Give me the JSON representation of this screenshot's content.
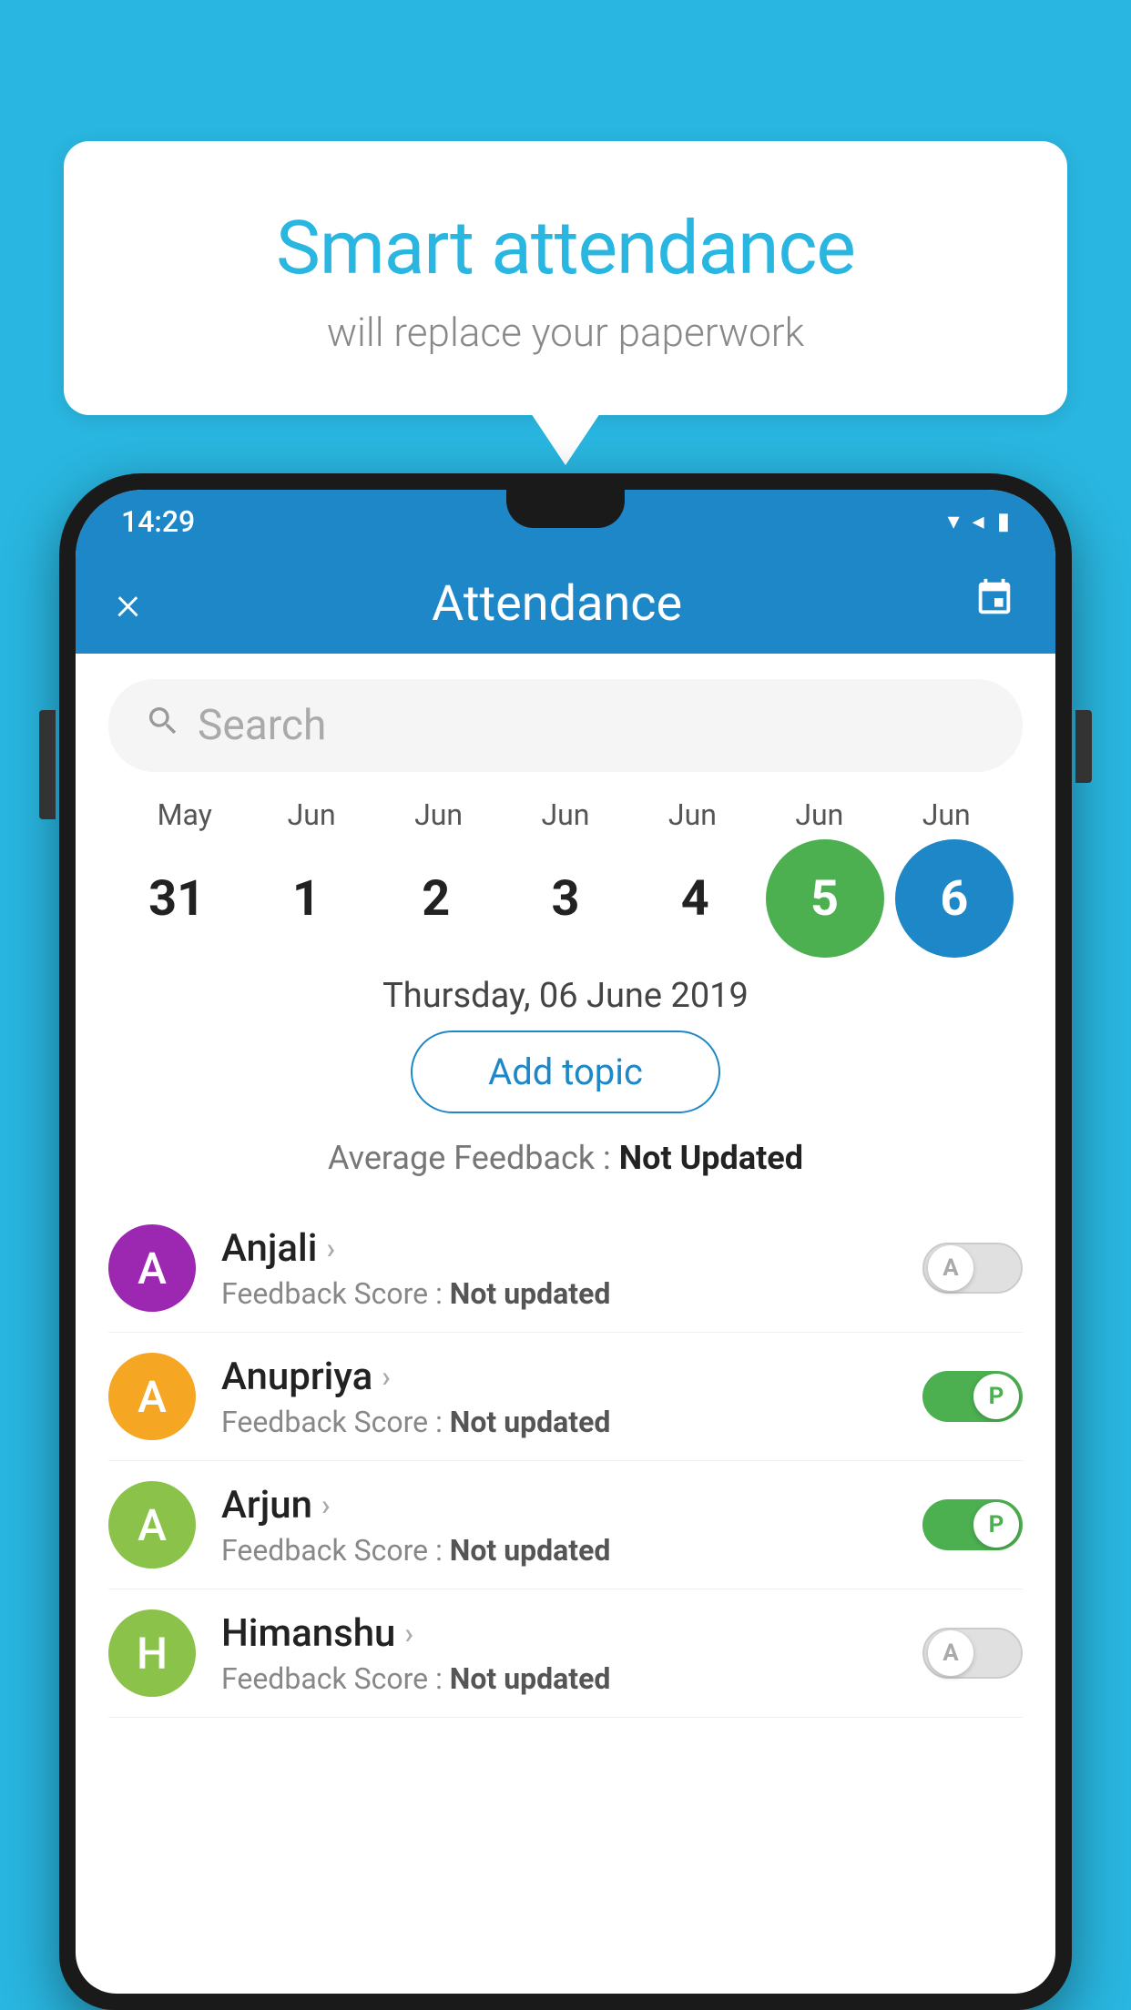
{
  "background": {
    "color": "#29b6e0"
  },
  "bubble": {
    "title": "Smart attendance",
    "subtitle": "will replace your paperwork"
  },
  "status_bar": {
    "time": "14:29",
    "icons": [
      "wifi",
      "signal",
      "battery"
    ]
  },
  "header": {
    "title": "Attendance",
    "close_label": "×",
    "calendar_icon": "📅"
  },
  "search": {
    "placeholder": "Search"
  },
  "calendar": {
    "months": [
      "May",
      "Jun",
      "Jun",
      "Jun",
      "Jun",
      "Jun",
      "Jun"
    ],
    "days": [
      "31",
      "1",
      "2",
      "3",
      "4",
      "5",
      "6"
    ],
    "today_index": 5,
    "selected_index": 6
  },
  "date_label": "Thursday, 06 June 2019",
  "add_topic_label": "Add topic",
  "avg_feedback": {
    "label": "Average Feedback : ",
    "value": "Not Updated"
  },
  "students": [
    {
      "name": "Anjali",
      "avatar_letter": "A",
      "avatar_color": "#9c27b0",
      "feedback": "Feedback Score : ",
      "feedback_value": "Not updated",
      "toggle": "off",
      "toggle_letter": "A"
    },
    {
      "name": "Anupriya",
      "avatar_letter": "A",
      "avatar_color": "#f5a623",
      "feedback": "Feedback Score : ",
      "feedback_value": "Not updated",
      "toggle": "on",
      "toggle_letter": "P"
    },
    {
      "name": "Arjun",
      "avatar_letter": "A",
      "avatar_color": "#8bc34a",
      "feedback": "Feedback Score : ",
      "feedback_value": "Not updated",
      "toggle": "on",
      "toggle_letter": "P"
    },
    {
      "name": "Himanshu",
      "avatar_letter": "H",
      "avatar_color": "#8bc34a",
      "feedback": "Feedback Score : ",
      "feedback_value": "Not updated",
      "toggle": "off",
      "toggle_letter": "A"
    }
  ]
}
